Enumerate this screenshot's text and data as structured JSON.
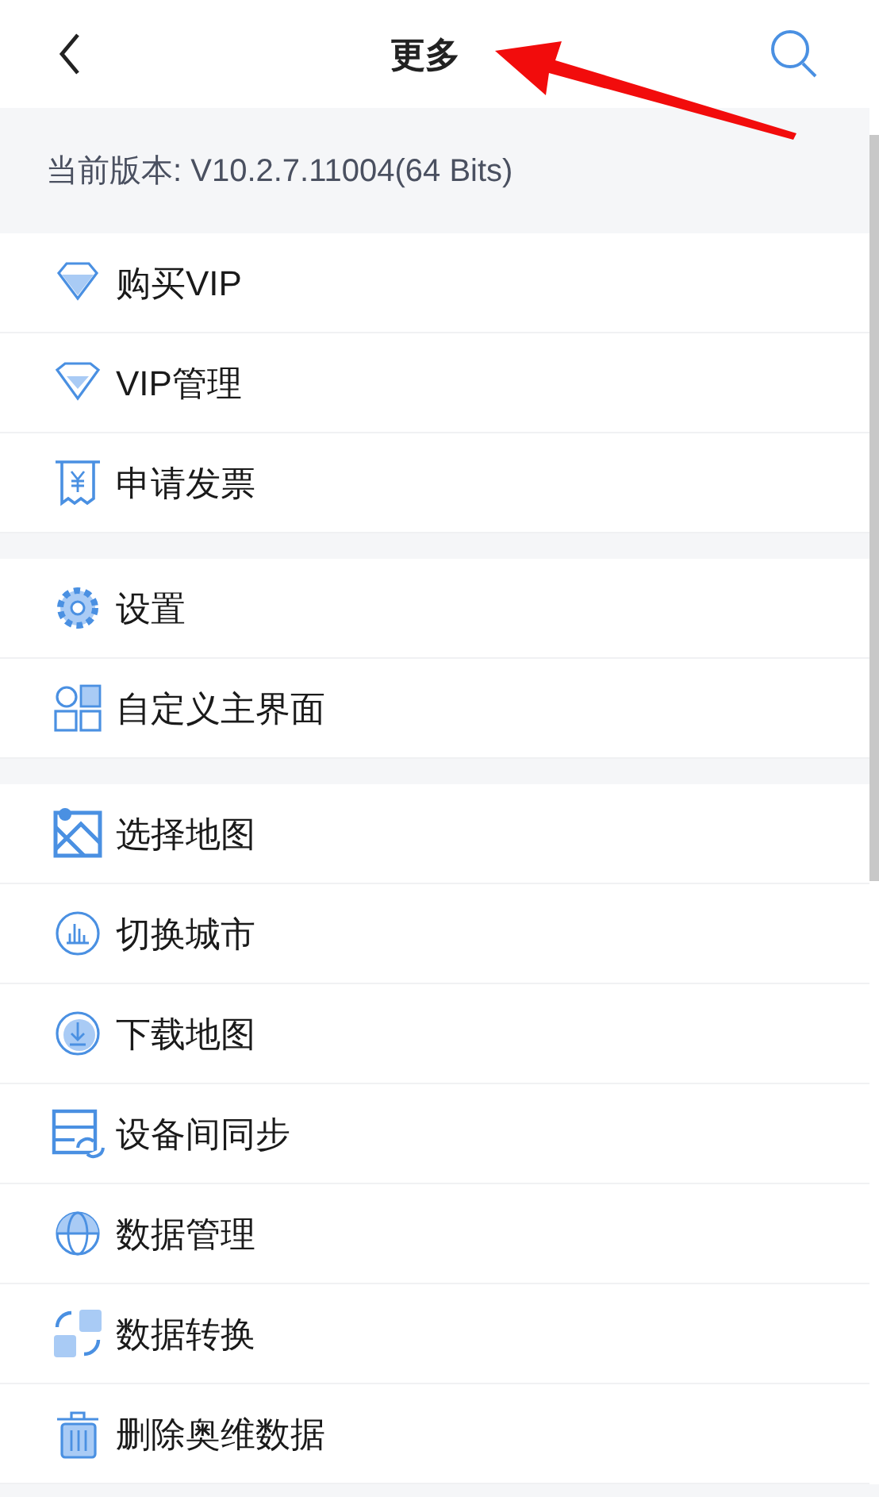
{
  "header": {
    "title": "更多"
  },
  "version": "当前版本: V10.2.7.11004(64 Bits)",
  "groups": [
    {
      "items": [
        "购买VIP",
        "VIP管理",
        "申请发票"
      ]
    },
    {
      "items": [
        "设置",
        "自定义主界面"
      ]
    },
    {
      "items": [
        "选择地图",
        "切换城市",
        "下载地图",
        "设备间同步",
        "数据管理",
        "数据转换",
        "删除奥维数据"
      ]
    }
  ]
}
